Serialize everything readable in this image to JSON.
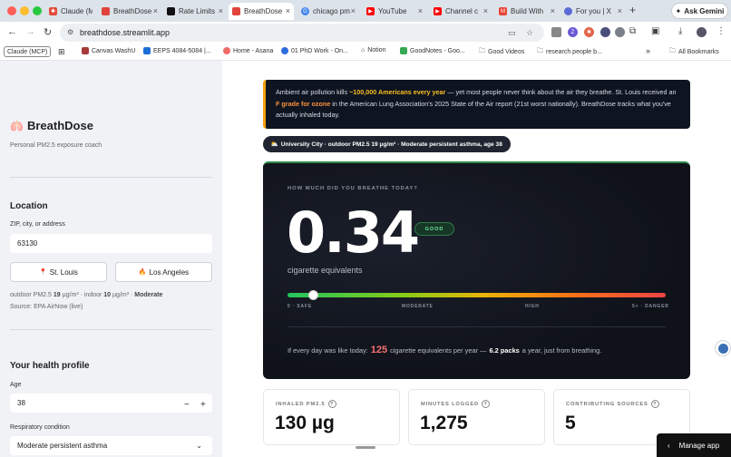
{
  "browser": {
    "tabs": [
      {
        "label": "Claude (MCP)",
        "color": "#e34b3b",
        "active": false
      },
      {
        "label": "BreathDose",
        "color": "#e0433c",
        "active": false
      },
      {
        "label": "Rate Limits",
        "color": "#111111",
        "active": false
      },
      {
        "label": "BreathDose",
        "color": "#e0433c",
        "active": true
      },
      {
        "label": "chicago pm",
        "color": "#4285f4",
        "active": false
      },
      {
        "label": "YouTube",
        "color": "#ff0000",
        "active": false
      },
      {
        "label": "Channel c",
        "color": "#ff0000",
        "active": false
      },
      {
        "label": "Build With",
        "color": "#ea4335",
        "active": false
      },
      {
        "label": "For you | X",
        "color": "#5b6bd5",
        "active": false
      }
    ],
    "new_tab": "+",
    "ask_gemini": "Ask Gemini",
    "url": "breathdose.streamlit.app",
    "bookmarks": [
      {
        "label": "Claude (MCP)",
        "color": "#e34b3b"
      },
      {
        "label": "Canvas WashU",
        "color": "#a63a3a"
      },
      {
        "label": "EEPS 4084-5084 |...",
        "color": "#1d6fd6"
      },
      {
        "label": "Home - Asana",
        "color": "#f06a6a"
      },
      {
        "label": "01 PhD Work - On...",
        "color": "#2d6cdf"
      },
      {
        "label": "Notion",
        "color": "#444444"
      },
      {
        "label": "GoodNotes - Goo...",
        "color": "#34a853"
      },
      {
        "label": "Good Videos",
        "color": "#666666"
      },
      {
        "label": "research people b...",
        "color": "#666666"
      }
    ],
    "more_bookmarks": "»",
    "all_bookmarks": "All Bookmarks"
  },
  "sidebar": {
    "brand": "BreathDose",
    "tagline": "Personal PM2.5 exposure coach",
    "location_heading": "Location",
    "zip_label": "ZIP, city, or address",
    "zip_value": "63130",
    "city_buttons": [
      {
        "icon": "📍",
        "label": "St. Louis"
      },
      {
        "icon": "🔥",
        "label": "Los Angeles"
      }
    ],
    "readings": {
      "outdoor_prefix": "outdoor PM2.5 ",
      "outdoor_value": "19",
      "outdoor_unit": " µg/m³ · indoor ",
      "indoor_value": "10",
      "indoor_unit": " µg/m³ · ",
      "category": "Moderate"
    },
    "source": "Source: EPA AirNow (live)",
    "health_heading": "Your health profile",
    "age_label": "Age",
    "age_value": "38",
    "stepper_minus": "−",
    "stepper_plus": "+",
    "condition_label": "Respiratory condition",
    "condition_value": "Moderate persistent asthma"
  },
  "main": {
    "banner": {
      "t1": "Ambient air pollution kills ",
      "h1": "~100,000 Americans every year",
      "t2": " — yet most people never think about the air they breathe. St. Louis received an ",
      "h2": "F grade for ozone",
      "t3": " in the American Lung Association's 2025 State of the Air report (21st worst nationally). BreathDose tracks what you've actually inhaled today."
    },
    "context_pill": "University City · outdoor PM2.5 19 µg/m³ · Moderate persistent asthma, age 38",
    "dose_card": {
      "kicker": "HOW MUCH DID YOU BREATHE TODAY?",
      "value": "0.34",
      "badge": "GOOD",
      "unit_label": "cigarette equivalents",
      "gauge_value": 0.34,
      "gauge_max": 5,
      "ticks": [
        "0 · SAFE",
        "MODERATE",
        "HIGH",
        "5+ · DANGER"
      ],
      "year_prefix": "If every day was like today:",
      "year_value": "125",
      "year_mid": "cigarette equivalents per year —",
      "year_packs": "6.2 packs",
      "year_suffix": "a year, just from breathing."
    },
    "metrics": [
      {
        "label": "INHALED PM2.5",
        "value": "130 µg"
      },
      {
        "label": "MINUTES LOGGED",
        "value": "1,275"
      },
      {
        "label": "CONTRIBUTING SOURCES",
        "value": "5"
      }
    ],
    "manage_app": "Manage app"
  }
}
